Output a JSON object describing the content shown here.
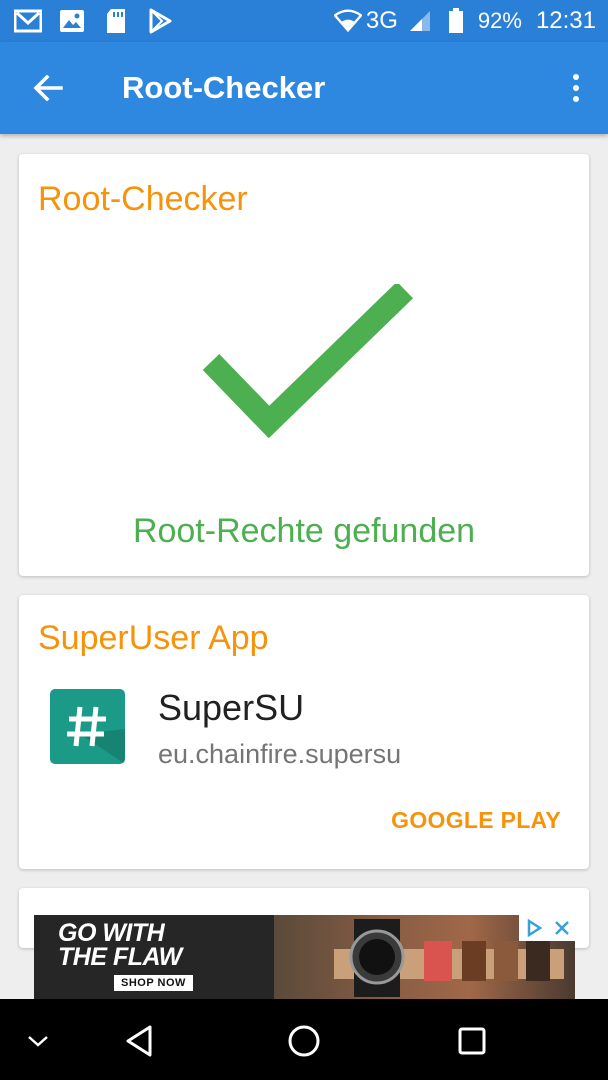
{
  "status_bar": {
    "network": "3G",
    "battery": "92%",
    "time": "12:31",
    "left_icons": [
      "gmail-icon",
      "image-icon",
      "sd-card-icon",
      "play-store-icon"
    ],
    "right_icons": [
      "wifi-icon",
      "signal-icon",
      "battery-icon"
    ]
  },
  "app_bar": {
    "title": "Root-Checker",
    "background": "#2e88e0"
  },
  "root_card": {
    "title": "Root-Checker",
    "status": "Root-Rechte gefunden",
    "status_color": "#4caf50",
    "icon": "checkmark-icon"
  },
  "superuser_card": {
    "title": "SuperUser App",
    "app_name": "SuperSU",
    "package": "eu.chainfire.supersu",
    "action": "GOOGLE PLAY",
    "icon": "hash-icon"
  },
  "ad": {
    "headline_1": "GO WITH",
    "headline_2": "THE FLAW",
    "cta": "SHOP NOW"
  },
  "nav_bar": {
    "buttons": [
      "chevron-down-icon",
      "back-icon",
      "home-icon",
      "recents-icon"
    ]
  },
  "colors": {
    "accent": "#f7930a",
    "primary": "#2e88e0",
    "primary_dark": "#2a7fd6",
    "success": "#4caf50"
  }
}
